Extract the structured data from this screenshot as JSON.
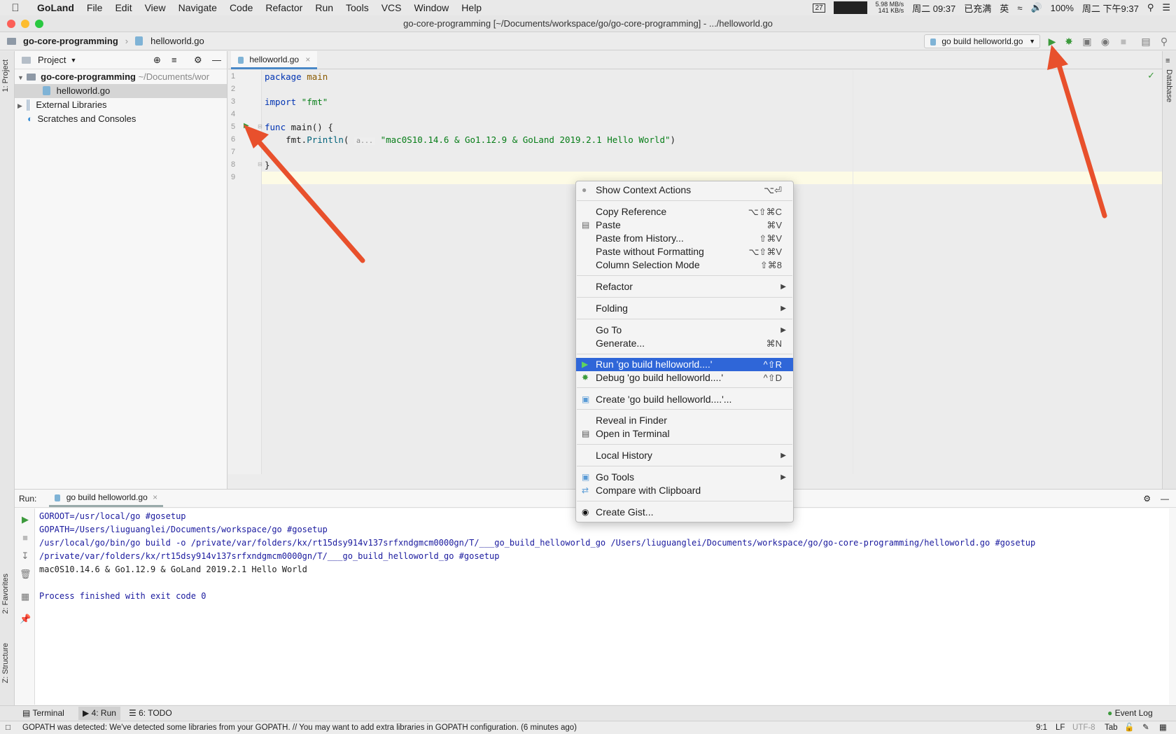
{
  "menubar": {
    "app": "GoLand",
    "items": [
      "File",
      "Edit",
      "View",
      "Navigate",
      "Code",
      "Refactor",
      "Run",
      "Tools",
      "VCS",
      "Window",
      "Help"
    ],
    "calendar": "27",
    "net_up": "5.98 MB/s",
    "net_down": "141 KB/s",
    "clock1": "周二 09:37",
    "power_label": "已充满",
    "ime": "英",
    "battery": "100%",
    "clock2": "周二 下午9:37"
  },
  "window": {
    "title": "go-core-programming [~/Documents/workspace/go/go-core-programming] - .../helloworld.go"
  },
  "navbar": {
    "project": "go-core-programming",
    "file": "helloworld.go",
    "run_config": "go build helloworld.go"
  },
  "left_stripe": {
    "project_tab": "1: Project",
    "favorites_tab": "2: Favorites",
    "structure_tab": "Z: Structure"
  },
  "right_stripe": {
    "database_tab": "Database"
  },
  "project_panel": {
    "title": "Project",
    "root_name": "go-core-programming",
    "root_path": "~/Documents/wor",
    "file": "helloworld.go",
    "external": "External Libraries",
    "scratches": "Scratches and Consoles"
  },
  "editor": {
    "tab": "helloworld.go",
    "line_numbers": [
      "1",
      "2",
      "3",
      "4",
      "5",
      "6",
      "7",
      "8",
      "9"
    ],
    "code": {
      "l1_kw": "package",
      "l1_name": " main",
      "l3_kw": "import",
      "l3_str": " \"fmt\"",
      "l5_kw": "func",
      "l5_rest": " main() {",
      "l6_pkg": "    fmt.",
      "l6_fn": "Println",
      "l6_open": "(",
      "l6_hint": "a...",
      "l6_str": "\"mac0S10.14.6 & Go1.12.9 & GoLand 2019.2.1 Hello World\"",
      "l6_close": ")",
      "l8": "}"
    }
  },
  "context_menu": {
    "show_context_actions": "Show Context Actions",
    "show_context_actions_sc": "⌥⏎",
    "copy_reference": "Copy Reference",
    "copy_reference_sc": "⌥⇧⌘C",
    "paste": "Paste",
    "paste_sc": "⌘V",
    "paste_history": "Paste from History...",
    "paste_history_sc": "⇧⌘V",
    "paste_noformat": "Paste without Formatting",
    "paste_noformat_sc": "⌥⇧⌘V",
    "column_selection": "Column Selection Mode",
    "column_selection_sc": "⇧⌘8",
    "refactor": "Refactor",
    "folding": "Folding",
    "go_to": "Go To",
    "generate": "Generate...",
    "generate_sc": "⌘N",
    "run": "Run 'go build helloworld....'",
    "run_sc": "^⇧R",
    "debug": "Debug 'go build helloworld....'",
    "debug_sc": "^⇧D",
    "create": "Create 'go build helloworld....'...",
    "reveal": "Reveal in Finder",
    "open_terminal": "Open in Terminal",
    "local_history": "Local History",
    "go_tools": "Go Tools",
    "compare_clipboard": "Compare with Clipboard",
    "create_gist": "Create Gist..."
  },
  "run_panel": {
    "label": "Run:",
    "tab": "go build helloworld.go",
    "output": [
      "GOROOT=/usr/local/go #gosetup",
      "GOPATH=/Users/liuguanglei/Documents/workspace/go #gosetup",
      "/usr/local/go/bin/go build -o /private/var/folders/kx/rt15dsy914v137srfxndgmcm0000gn/T/___go_build_helloworld_go /Users/liuguanglei/Documents/workspace/go/go-core-programming/helloworld.go #gosetup",
      "/private/var/folders/kx/rt15dsy914v137srfxndgmcm0000gn/T/___go_build_helloworld_go #gosetup",
      "mac0S10.14.6 & Go1.12.9 & GoLand 2019.2.1 Hello World",
      "Process finished with exit code 0"
    ]
  },
  "tool_windows": {
    "terminal": "Terminal",
    "run": "4: Run",
    "todo": "6: TODO",
    "event_log": "Event Log"
  },
  "status": {
    "message": "GOPATH was detected: We've detected some libraries from your GOPATH. // You may want to add extra libraries in GOPATH configuration. (6 minutes ago)",
    "position": "9:1",
    "line_sep": "LF",
    "encoding": "UTF-8",
    "indent": "Tab"
  },
  "colors": {
    "accent": "#2f66d8",
    "arrow": "#e8502c",
    "run_green": "#3c9a3c"
  }
}
